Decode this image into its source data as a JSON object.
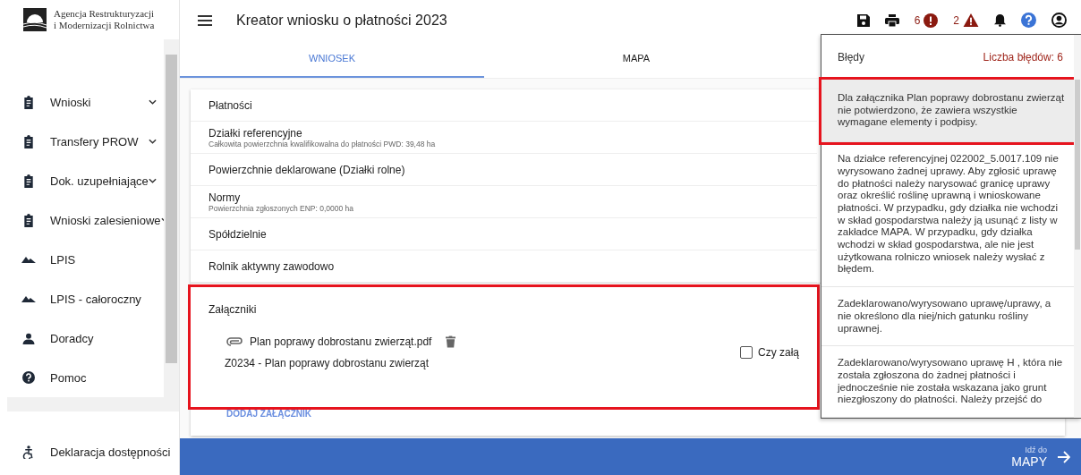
{
  "sidebar": {
    "logo_lines": [
      "Agencja Restrukturyzacji",
      "i Modernizacji Rolnictwa"
    ],
    "items": [
      {
        "label": "Wnioski",
        "kind": "documents",
        "expandable": true
      },
      {
        "label": "Transfery PROW",
        "kind": "documents",
        "expandable": true
      },
      {
        "label": "Dok. uzupełniające",
        "kind": "documents",
        "expandable": true
      },
      {
        "label": "Wnioski zalesieniowe",
        "kind": "documents",
        "expandable": true
      },
      {
        "label": "LPIS",
        "kind": "map",
        "expandable": false
      },
      {
        "label": "LPIS - całoroczny",
        "kind": "map",
        "expandable": false
      },
      {
        "label": "Doradcy",
        "kind": "people",
        "expandable": false
      },
      {
        "label": "Pomoc",
        "kind": "support",
        "expandable": false
      }
    ],
    "footer_link": "Deklaracja dostępności"
  },
  "header": {
    "title": "Kreator wniosku o płatności 2023",
    "error_count": "6",
    "warning_count": "2"
  },
  "tabs": [
    {
      "label": "WNIOSEK",
      "selected": true
    },
    {
      "label": "MAPA",
      "selected": false
    }
  ],
  "sections": [
    {
      "title": "Płatności"
    },
    {
      "title": "Działki referencyjne",
      "subtitle": "Całkowita powierzchnia kwalifikowalna do płatności PWD: 39,48 ha"
    },
    {
      "title": "Powierzchnie deklarowane (Działki rolne)"
    },
    {
      "title": "Normy",
      "subtitle": "Powierzchnia zgłoszonych ENP: 0,0000 ha"
    },
    {
      "title": "Spółdzielnie"
    },
    {
      "title": "Rolnik aktywny zawodowo"
    }
  ],
  "attachments": {
    "title": "Załączniki",
    "highlighted": true,
    "files": [
      {
        "name": "Plan poprawy dobrostanu zwierząt.pdf",
        "type": "Z0234 - Plan poprawy dobrostanu zwierząt",
        "checkbox_label": "Czy załą",
        "checked": false
      }
    ],
    "add_button": "DODAJ ZAŁĄCZNIK"
  },
  "errors_panel": {
    "title": "Błędy",
    "count_label": "Liczba błędów: 6",
    "items": [
      {
        "text": "Dla załącznika Plan poprawy dobrostanu zwierząt nie potwierdzono, że zawiera wszystkie wymagane elementy i podpisy.",
        "highlighted": true
      },
      {
        "text": "Na działce referencyjnej 022002_5.0017.109 nie wyrysowano żadnej uprawy. Aby zgłosić uprawę do płatności należy narysować granicę uprawy oraz określić roślinę uprawną i wnioskowane płatności. W przypadku, gdy działka nie wchodzi w skład gospodarstwa należy ją usunąć z listy w zakładce MAPA. W przypadku, gdy działka wchodzi w skład gospodarstwa, ale nie jest użytkowana rolniczo wniosek należy wysłać z błędem.",
        "highlighted": false
      },
      {
        "text": "Zadeklarowano/wyrysowano uprawę/uprawy, a nie określono dla niej/nich gatunku rośliny uprawnej.",
        "highlighted": false
      },
      {
        "text": "Zadeklarowano/wyrysowano uprawę H , która nie została zgłoszona do żadnej płatności i jednocześnie nie została wskazana jako grunt niezgłoszony do płatności. Należy przejść do",
        "highlighted": false
      }
    ]
  },
  "footer_bar": {
    "small_label": "Idź do",
    "big_label": "MAPY"
  }
}
